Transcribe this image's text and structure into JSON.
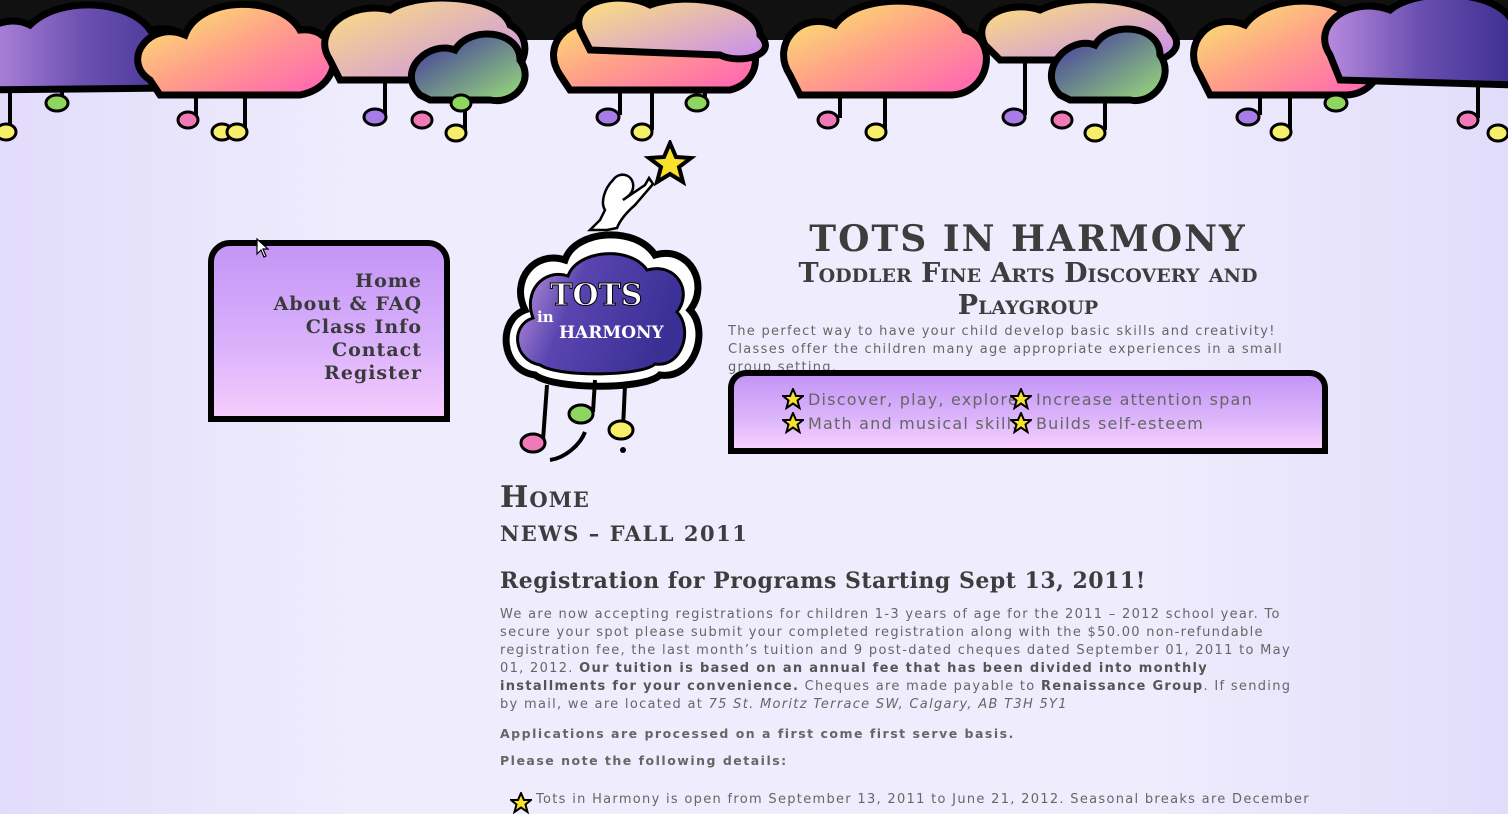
{
  "nav": {
    "items": [
      {
        "label": "Home"
      },
      {
        "label": "About & FAQ"
      },
      {
        "label": "Class Info"
      },
      {
        "label": "Contact"
      },
      {
        "label": "Register"
      }
    ]
  },
  "logo": {
    "line1": "TOTS",
    "line2": "in",
    "line3": "HARMONY"
  },
  "header": {
    "title": "TOTS IN HARMONY",
    "subtitle": "Toddler Fine Arts Discovery and Playgroup",
    "intro": "The perfect way to have your child develop basic skills and creativity! Classes offer the children many age appropriate experiences in a small group setting."
  },
  "features": [
    "Discover, play, explore",
    "Increase attention span",
    "Math and musical skills",
    "Builds self-esteem"
  ],
  "content": {
    "page_title": "Home",
    "news_title": "NEWS – FALL 2011",
    "reg_title": "Registration for Programs Starting Sept 13, 2011!",
    "p1_a": "We are now accepting registrations for children 1-3 years of age for the 2011 – 2012 school year. To secure your spot please submit your completed registration along with the $50.00 non-refundable registration fee, the last month’s tuition and 9 post-dated cheques dated September 01, 2011 to May 01, 2012.",
    "p1_b": "Our tuition is based on an annual fee that has been divided into monthly installments for your convenience.",
    "p1_c": "Cheques are made payable to",
    "p1_d": "Renaissance Group",
    "p1_e": ". If sending by mail, we are located at",
    "p1_f": "75 St. Moritz Terrace SW, Calgary, AB T3H 5Y1",
    "p2": "Applications are processed on a first come first serve basis.",
    "p3": "Please note the following details:",
    "bullet1": "Tots in Harmony is open from September 13, 2011 to June 21, 2012. Seasonal breaks are December"
  },
  "colors": {
    "background": "#efedfd",
    "panel_top": "#c495f6",
    "panel_bottom": "#f6ccfd",
    "text_dark": "#3d3d3d",
    "star": "#f7e12a"
  }
}
